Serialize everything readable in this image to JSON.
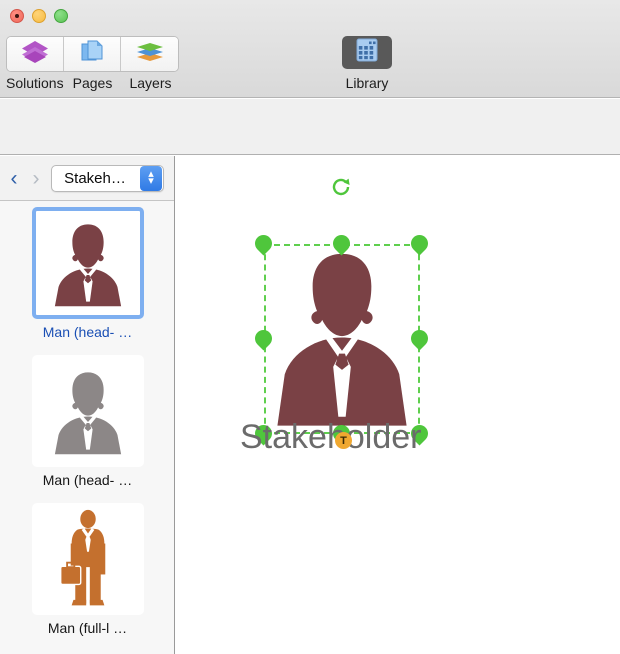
{
  "window": {
    "controls": [
      {
        "name": "close",
        "color": "#ef6a5d"
      },
      {
        "name": "minimize",
        "color": "#f6bb42"
      },
      {
        "name": "maximize",
        "color": "#5bc254"
      }
    ]
  },
  "toolbar": {
    "left_group": [
      {
        "label": "Solutions",
        "icon": "solutions-icon",
        "selected": false
      },
      {
        "label": "Pages",
        "icon": "pages-icon",
        "selected": false
      },
      {
        "label": "Layers",
        "icon": "layers-icon",
        "selected": false
      }
    ],
    "library": {
      "label": "Library",
      "icon": "library-grid-icon",
      "selected": true,
      "active_bg": "#595959"
    }
  },
  "tools": {
    "selection_group": [
      {
        "name": "pointer-tool",
        "icon": "cursor-arrow-icon",
        "active": true
      },
      {
        "name": "text-box-tool",
        "icon": "dashed-text-icon",
        "active": false
      }
    ],
    "shapes_group": [
      {
        "name": "rectangle-tool",
        "icon": "rectangle-icon",
        "active": false
      },
      {
        "name": "ellipse-tool",
        "icon": "ellipse-icon",
        "active": false
      },
      {
        "name": "text-tool",
        "icon": "letter-a-icon",
        "active": false
      },
      {
        "name": "textbox-tool",
        "icon": "text-field-icon",
        "active": false
      },
      {
        "name": "callout-tool",
        "icon": "callout-icon",
        "active": false
      },
      {
        "name": "arrow-tool",
        "icon": "arrow-icon",
        "active": false
      },
      {
        "name": "line-tool",
        "icon": "line-icon",
        "active": false
      }
    ]
  },
  "sidebar": {
    "nav": {
      "back_label": "‹",
      "forward_label": "›",
      "back_enabled": true,
      "forward_enabled": false
    },
    "library_select": {
      "value": "Stakeh…",
      "stepper_up": "▴",
      "stepper_down": "▾"
    },
    "items": [
      {
        "label": "Man (head- …",
        "selected": true,
        "color": "#7a4145",
        "type": "bust"
      },
      {
        "label": "Man (head- …",
        "selected": false,
        "color": "#8c8787",
        "type": "bust"
      },
      {
        "label": "Man (full-l …",
        "selected": false,
        "color": "#c4702e",
        "type": "full"
      }
    ]
  },
  "canvas": {
    "selected_shape": {
      "name": "Stakeholder",
      "label_text": "Stakeholder",
      "label_color": "#6b6b6b",
      "fill_color": "#7a4145",
      "selection_color": "#4fc63c",
      "rotation_handle": "rotate-icon",
      "text_badge": "T",
      "badge_color": "#f0a830",
      "handle_count": 8
    }
  },
  "colors": {
    "toolbar_bg": "#e2e2e2",
    "tools_bg": "#f0f0f0",
    "sidebar_bg": "#f7f7f7",
    "canvas_bg": "#ffffff",
    "accent_blue": "#2f7ae5",
    "selection_green": "#4fc63c"
  }
}
